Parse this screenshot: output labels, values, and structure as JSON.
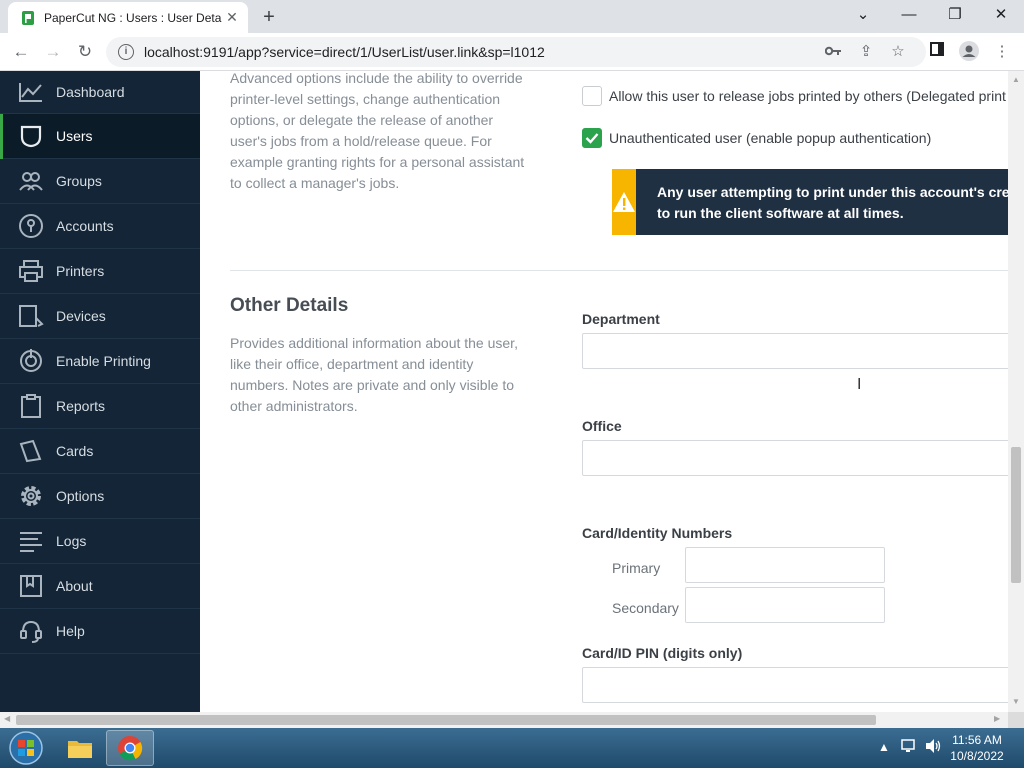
{
  "browser": {
    "tab_title": "PaperCut NG : Users : User Detail",
    "url": "localhost:9191/app?service=direct/1/UserList/user.link&sp=l1012",
    "new_tab": "+"
  },
  "sidebar": {
    "items": [
      {
        "label": "Dashboard",
        "icon": "dashboard-icon"
      },
      {
        "label": "Users",
        "icon": "users-icon",
        "active": true
      },
      {
        "label": "Groups",
        "icon": "groups-icon"
      },
      {
        "label": "Accounts",
        "icon": "accounts-icon"
      },
      {
        "label": "Printers",
        "icon": "printer-icon"
      },
      {
        "label": "Devices",
        "icon": "devices-icon"
      },
      {
        "label": "Enable Printing",
        "icon": "enable-printing-icon"
      },
      {
        "label": "Reports",
        "icon": "reports-icon"
      },
      {
        "label": "Cards",
        "icon": "cards-icon"
      },
      {
        "label": "Options",
        "icon": "gear-icon"
      },
      {
        "label": "Logs",
        "icon": "logs-icon"
      },
      {
        "label": "About",
        "icon": "about-icon"
      },
      {
        "label": "Help",
        "icon": "help-icon"
      }
    ]
  },
  "advanced": {
    "description": "Advanced options include the ability to override printer-level settings, change authentication options, or delegate the release of another user's jobs from a hold/release queue. For example granting rights for a personal assistant to collect a manager's jobs.",
    "delegated_label": "Allow this user to release jobs printed by others (Delegated print",
    "delegated_checked": false,
    "unauth_label": "Unauthenticated user (enable popup authentication)",
    "unauth_checked": true,
    "warning_line1": "Any user attempting to print under this account's cred",
    "warning_line2": "to run the client software at all times."
  },
  "other_details": {
    "title": "Other Details",
    "description": "Provides additional information about the user, like their office, department and identity numbers. Notes are private and only visible to other administrators.",
    "department_label": "Department",
    "department_value": "",
    "office_label": "Office",
    "office_value": "",
    "card_label": "Card/Identity Numbers",
    "primary_label": "Primary",
    "primary_value": "",
    "secondary_label": "Secondary",
    "secondary_value": "",
    "pin_label": "Card/ID PIN (digits only)",
    "pin_value": ""
  },
  "taskbar": {
    "time": "11:56 AM",
    "date": "10/8/2022"
  },
  "colors": {
    "sidebar_bg": "#132536",
    "active_accent": "#39a846",
    "checkbox_green": "#2aa34c",
    "warning_yellow": "#f7b500",
    "warning_bg": "#203043"
  }
}
